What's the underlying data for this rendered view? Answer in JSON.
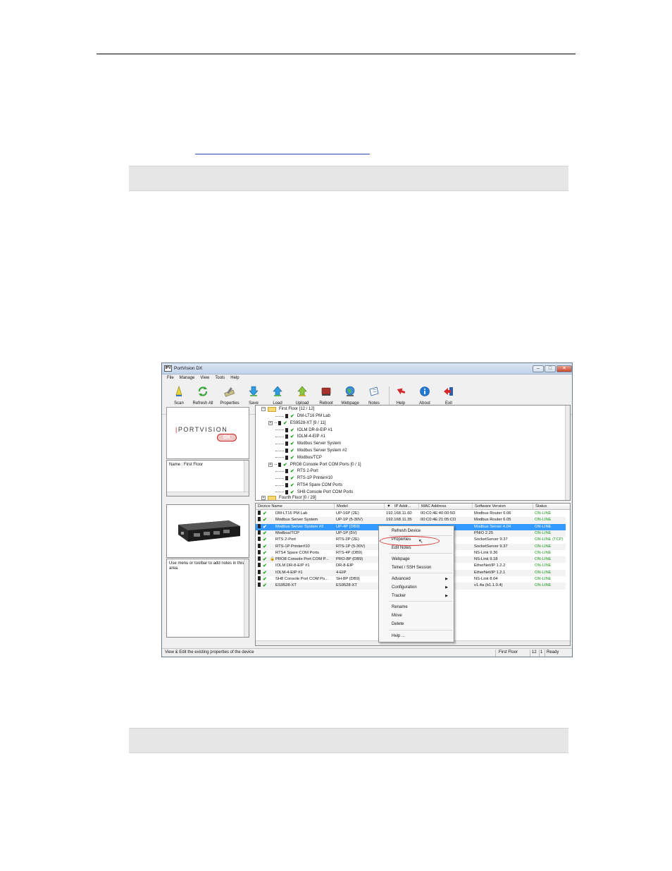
{
  "window": {
    "icon": "IPV",
    "title": "PortVision DX"
  },
  "menu": [
    "File",
    "Manage",
    "View",
    "Tools",
    "Help"
  ],
  "toolbar": [
    {
      "label": "Scan",
      "icon": "scan-icon"
    },
    {
      "label": "Refresh All",
      "icon": "refresh-icon"
    },
    {
      "label": "Properties",
      "icon": "properties-icon"
    },
    {
      "label": "Save",
      "icon": "save-icon"
    },
    {
      "label": "Load",
      "icon": "load-icon"
    },
    {
      "label": "Upload",
      "icon": "upload-icon"
    },
    {
      "label": "Reboot",
      "icon": "reboot-icon"
    },
    {
      "label": "Webpage",
      "icon": "globe-icon"
    },
    {
      "label": "Notes",
      "icon": "notes-icon"
    },
    {
      "label": "Help",
      "icon": "help-icon"
    },
    {
      "label": "About",
      "icon": "info-icon"
    },
    {
      "label": "Exit",
      "icon": "exit-icon"
    }
  ],
  "logo": {
    "text_a": "PORTVISION",
    "text_b": "DX"
  },
  "name_panel": "Name : First Floor",
  "notes_panel": "Use menu or toolbar to add notes in this area.",
  "tree": {
    "root": "First Floor [12 / 12]",
    "items": [
      "DM-LT16 PM Lab",
      "ES9528-XT [9 / 11]",
      "IOLM DR-8-EIP #1",
      "IOLM-4-EIP #1",
      "Modbus Server System",
      "Modbus Server System #2",
      "Modbus/TCP",
      "PRO8 Console Port COM Ports [0 / 1]",
      "RTS 2-Port",
      "RTS-1P Printer#10",
      "RTS4 Spare COM Ports",
      "SH8 Console Port COM Ports"
    ],
    "next": "Fourth Floor [0 / 29]"
  },
  "grid": {
    "columns": [
      "Device Name",
      "Model",
      "IP Addr...",
      "MAC Address",
      "Software Version",
      "Status"
    ],
    "rows": [
      {
        "name": "DM-LT16 PM Lab",
        "model": "UP-16P (2E)",
        "ip": "192.168.11.60",
        "mac": "00:C0:4E:40:00:5D",
        "sw": "Modbus Router 6.06",
        "status": "ON-LINE"
      },
      {
        "name": "Modbus Server System",
        "model": "UP-1P (5-30V)",
        "ip": "192.168.11.35",
        "mac": "00:C0:4E:21:05:CD",
        "sw": "Modbus Router 6.05",
        "status": "ON-LINE"
      },
      {
        "name": "Modbus Server System #2",
        "model": "UP-4P (DB9)",
        "ip": "",
        "mac": "",
        "sw": "Modbus Server 4.04",
        "status": "ON-LINE"
      },
      {
        "name": "Modbus/TCP",
        "model": "UP-1P (5V)",
        "ip": "",
        "mac": "A",
        "sw": "PNIO 2.25",
        "status": "ON-LINE"
      },
      {
        "name": "RTS 2-Port",
        "model": "RTS-2P (2E)",
        "ip": "",
        "mac": "",
        "sw": "SocketServer 9.37",
        "status": "ON-LINE (TCP)"
      },
      {
        "name": "RTS-1P Printer#10",
        "model": "RTS-1P (5-30V)",
        "ip": "",
        "mac": "",
        "sw": "SocketServer 9.37",
        "status": "ON-LINE"
      },
      {
        "name": "RTS4 Spare COM Ports",
        "model": "RTS-4P (DB9)",
        "ip": "",
        "mac": "C",
        "sw": "NS-Link 9.36",
        "status": "ON-LINE"
      },
      {
        "name": "PRO8 Console Port COM P...",
        "model": "PRO-8P (DB9)",
        "ip": "",
        "mac": "3",
        "sw": "NS-Link 9.18",
        "status": "ON-LINE"
      },
      {
        "name": "IOLM DR-8-EIP #1",
        "model": "DR-8-EIP",
        "ip": "",
        "mac": "F",
        "sw": "EtherNet/IP 1.2.2",
        "status": "ON-LINE"
      },
      {
        "name": "IOLM-4-EIP #1",
        "model": "4-EIP",
        "ip": "",
        "mac": "F",
        "sw": "EtherNet/IP 1.2.1",
        "status": "ON-LINE"
      },
      {
        "name": "SH8 Console Port COM Po...",
        "model": "SH-8P (DB9)",
        "ip": "",
        "mac": "D",
        "sw": "NS-Link 8.04",
        "status": "ON-LINE"
      },
      {
        "name": "ES9528-XT",
        "model": "ES9528-XT",
        "ip": "",
        "mac": "2",
        "sw": "v1.4a (b1.1.0.4)",
        "status": "ON-LINE"
      }
    ]
  },
  "context_menu": {
    "items": [
      "Refresh Device",
      "Properties",
      "Edit Notes",
      "Webpage",
      "Telnet / SSH Session",
      "Advanced",
      "Configuration",
      "Tracker",
      "Rename",
      "Move",
      "Delete",
      "Help ..."
    ]
  },
  "statusbar": {
    "message": "View & Edit the existing properties of the device",
    "location": "First Floor",
    "count_a": "12",
    "count_b": "1",
    "state": "Ready"
  },
  "colors": {
    "accent": "#3399ff",
    "online": "#1d9a1d",
    "logo_red": "#c8251f"
  }
}
